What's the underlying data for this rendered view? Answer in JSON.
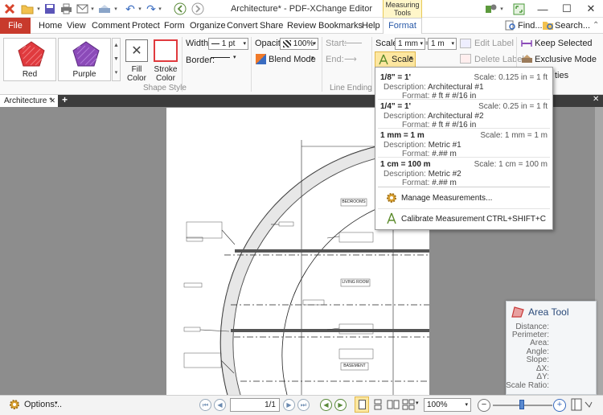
{
  "window": {
    "title": "Architecture* - PDF-XChange Editor",
    "contextual_tab_group": "Measuring Tools"
  },
  "menu": {
    "file": "File",
    "tabs": [
      "Home",
      "View",
      "Comment",
      "Protect",
      "Form",
      "Organize",
      "Convert",
      "Share",
      "Review",
      "Bookmarks",
      "Help"
    ],
    "format": "Format",
    "find": "Find...",
    "search": "Search..."
  },
  "ribbon": {
    "style_presets": [
      {
        "label": "Red",
        "color": "#e03a3e"
      },
      {
        "label": "Purple",
        "color": "#8b4ab8"
      }
    ],
    "fill_color": "Fill Color",
    "stroke_color": "Stroke Color",
    "shape_style": "Shape Style",
    "width_label": "Width:",
    "width_value": "1 pt",
    "border_label": "Border:",
    "opacity_label": "Opacity:",
    "opacity_value": "100%",
    "blend_mode": "Blend Mode",
    "start_label": "Start:",
    "end_label": "End:",
    "line_ending": "Line Ending",
    "scale_label": "Scale:",
    "scale_from": "1 mm",
    "scale_to": "1 m",
    "scale_button": "Scale",
    "edit_label": "Edit Label",
    "delete_label": "Delete Label",
    "keep_selected": "Keep Selected",
    "exclusive_mode": "Exclusive Mode",
    "properties_partial": "ties"
  },
  "doc_tab": {
    "name": "Architecture *"
  },
  "scale_dropdown": {
    "items": [
      {
        "name": "1/8\" = 1'",
        "scale": "Scale: 0.125 in = 1 ft",
        "desc_label": "Description:",
        "description": "Architectural #1",
        "format_label": "Format:",
        "format": "# ft # #/16 in"
      },
      {
        "name": "1/4\" = 1'",
        "scale": "Scale: 0.25 in = 1 ft",
        "desc_label": "Description:",
        "description": "Architectural #2",
        "format_label": "Format:",
        "format": "# ft # #/16 in"
      },
      {
        "name": "1 mm = 1 m",
        "scale": "Scale: 1 mm = 1 m",
        "desc_label": "Description:",
        "description": "Metric #1",
        "format_label": "Format:",
        "format": "#.## m"
      },
      {
        "name": "1 cm = 100 m",
        "scale": "Scale: 1 cm = 100 m",
        "desc_label": "Description:",
        "description": "Metric #2",
        "format_label": "Format:",
        "format": "#.## m"
      }
    ],
    "manage": "Manage Measurements...",
    "calibrate": "Calibrate Measurement",
    "calibrate_shortcut": "CTRL+SHIFT+C"
  },
  "drawing": {
    "rooms": [
      "BEDROOMS",
      "LIVING ROOM",
      "BASEMENT"
    ]
  },
  "area_tool": {
    "title": "Area Tool",
    "fields": [
      "Distance:",
      "Perimeter:",
      "Area:",
      "Angle:",
      "Slope:",
      "ΔX:",
      "ΔY:",
      "Scale Ratio:"
    ]
  },
  "statusbar": {
    "options": "Options...",
    "page": "1/1",
    "zoom": "100%"
  }
}
